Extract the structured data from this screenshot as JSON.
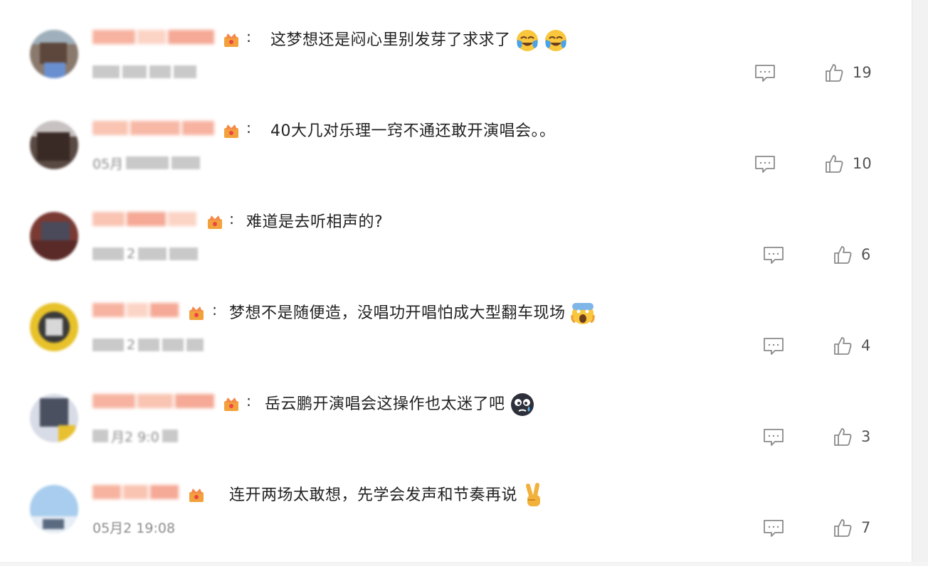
{
  "comments": [
    {
      "text": "这梦想还是闷心里别发芽了求求了",
      "emoji": [
        "cry-laugh-emoji",
        "cry-laugh-emoji"
      ],
      "date": "",
      "likes": "19"
    },
    {
      "text": "40大几对乐理一窍不通还敢开演唱会。。",
      "emoji": [],
      "date": "05月",
      "likes": "10"
    },
    {
      "text": "难道是去听相声的?",
      "emoji": [],
      "date": "2",
      "likes": "6"
    },
    {
      "text": "梦想不是随便造，没唱功开唱怕成大型翻车现场",
      "emoji": [
        "scream-emoji"
      ],
      "date": "2",
      "likes": "4"
    },
    {
      "text": "岳云鹏开演唱会这操作也太迷了吧",
      "emoji": [
        "sweat-face-emoji"
      ],
      "date": "月2  9:0",
      "likes": "3"
    },
    {
      "text": "连开两场太敢想，先学会发声和节奏再说",
      "emoji": [
        "victory-hand-emoji"
      ],
      "date": "05月2  19:08",
      "likes": "7"
    }
  ],
  "colors": {
    "name_blur": "#f7b9a6",
    "badge": "#f2a23c",
    "icon": "#8a8a8a"
  },
  "icons": {
    "reply": "comment-icon",
    "like": "thumbs-up-icon",
    "badge": "vip-crown-badge"
  }
}
